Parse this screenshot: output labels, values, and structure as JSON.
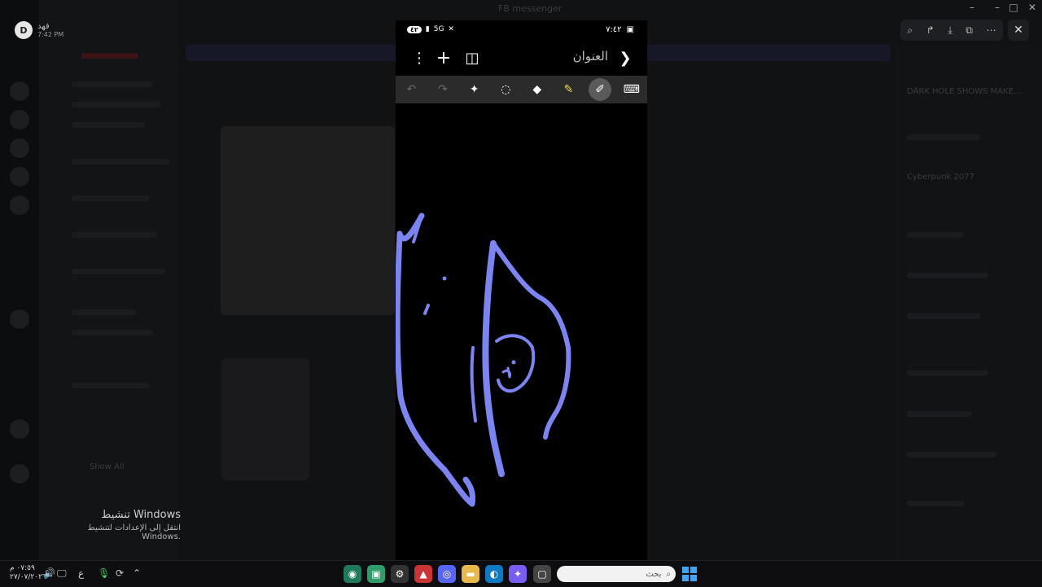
{
  "background_app": {
    "user_initial": "D",
    "user_name": "فهد",
    "user_time": "7:42 PM",
    "window_title": "FB messenger",
    "show_all": "Show All",
    "side_texts": [
      "DARK HOLE SHOWS MAKE…",
      "Cyberpunk 2077"
    ]
  },
  "viewer": {
    "tools": [
      "zoom-icon",
      "rotate-icon",
      "download-icon",
      "open-icon",
      "more-icon"
    ],
    "close_glyph": "✕"
  },
  "phone": {
    "status": {
      "time": "٧:٤٢",
      "badge": "٤٢",
      "network": "5G"
    },
    "note": {
      "title": "العنوان",
      "back_glyph": "❯",
      "add_glyph": "+",
      "more_glyph": "⋮",
      "layout_glyph": "◫"
    },
    "tools": [
      {
        "name": "undo",
        "glyph": "↶",
        "state": "disabled"
      },
      {
        "name": "redo",
        "glyph": "↷",
        "state": "disabled"
      },
      {
        "name": "ai-assist",
        "glyph": "✦",
        "state": "normal"
      },
      {
        "name": "lasso",
        "glyph": "◌",
        "state": "normal"
      },
      {
        "name": "eraser",
        "glyph": "◆",
        "state": "normal"
      },
      {
        "name": "highlighter",
        "glyph": "✎",
        "state": "normal"
      },
      {
        "name": "pen",
        "glyph": "✐",
        "state": "active"
      },
      {
        "name": "keyboard",
        "glyph": "⌨",
        "state": "normal"
      }
    ],
    "ink_color": "#7b84f2"
  },
  "activation": {
    "title": "تنشيط Windows",
    "subtitle": "انتقل إلى الإعدادات لتنشيط Windows."
  },
  "taskbar": {
    "clock_time": "٠٧:٥٩ م",
    "clock_date": "٢٧/٠٧/٢٠٢٦",
    "language": "ع",
    "search_placeholder": "بحث"
  }
}
